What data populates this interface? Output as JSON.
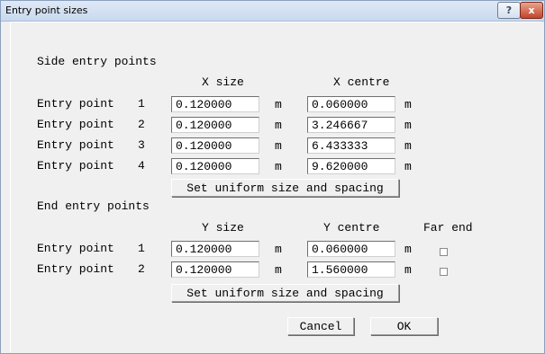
{
  "window": {
    "title": "Entry point sizes",
    "help_label": "?",
    "close_label": "x"
  },
  "side": {
    "heading": "Side entry points",
    "col_size": "X size",
    "col_centre": "X centre",
    "rows": [
      {
        "label": "Entry point",
        "num": "1",
        "size": "0.120000",
        "unit1": "m",
        "centre": "0.060000",
        "unit2": "m"
      },
      {
        "label": "Entry point",
        "num": "2",
        "size": "0.120000",
        "unit1": "m",
        "centre": "3.246667",
        "unit2": "m"
      },
      {
        "label": "Entry point",
        "num": "3",
        "size": "0.120000",
        "unit1": "m",
        "centre": "6.433333",
        "unit2": "m"
      },
      {
        "label": "Entry point",
        "num": "4",
        "size": "0.120000",
        "unit1": "m",
        "centre": "9.620000",
        "unit2": "m"
      }
    ],
    "uniform_button": "Set uniform size and spacing"
  },
  "end": {
    "heading": "End entry points",
    "col_size": "Y size",
    "col_centre": "Y centre",
    "col_far": "Far end",
    "rows": [
      {
        "label": "Entry point",
        "num": "1",
        "size": "0.120000",
        "unit1": "m",
        "centre": "0.060000",
        "unit2": "m",
        "far_end": false
      },
      {
        "label": "Entry point",
        "num": "2",
        "size": "0.120000",
        "unit1": "m",
        "centre": "1.560000",
        "unit2": "m",
        "far_end": false
      }
    ],
    "uniform_button": "Set uniform size and spacing"
  },
  "footer": {
    "cancel_label": "Cancel",
    "ok_label": "OK"
  }
}
